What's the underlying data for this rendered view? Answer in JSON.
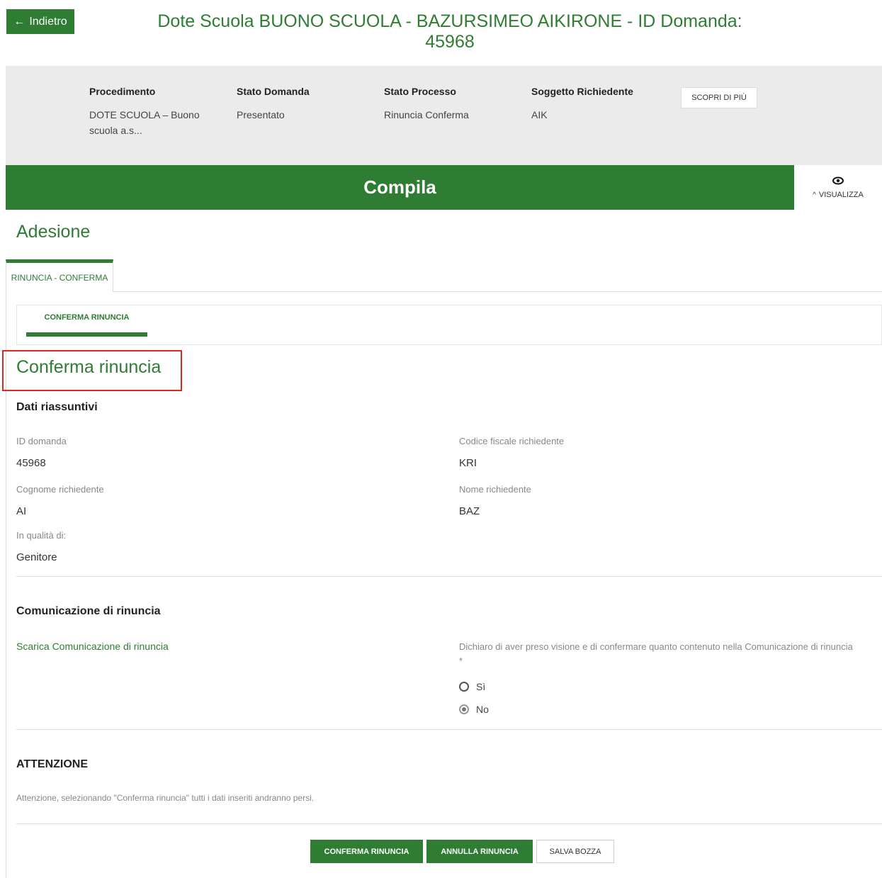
{
  "header": {
    "back_label": "Indietro",
    "back_arrow": "←",
    "title_line1": "Dote Scuola BUONO SCUOLA - BAZURSIMEO AIKIRONE - ID Domanda:",
    "title_line2": "45968"
  },
  "info": {
    "procedimento_label": "Procedimento",
    "procedimento_value": "DOTE SCUOLA – Buono scuola a.s...",
    "stato_domanda_label": "Stato Domanda",
    "stato_domanda_value": "Presentato",
    "stato_processo_label": "Stato Processo",
    "stato_processo_value": "Rinuncia Conferma",
    "soggetto_label": "Soggetto Richiedente",
    "soggetto_value": "AIK",
    "scopri_label": "SCOPRI DI PIÙ"
  },
  "bar": {
    "compila_label": "Compila",
    "visualizza_label": "VISUALIZZA"
  },
  "section_title": "Adesione",
  "tabs": {
    "main_tab": "RINUNCIA - CONFERMA",
    "sub_tab": "CONFERMA RINUNCIA"
  },
  "form": {
    "title": "Conferma rinuncia",
    "dati_heading": "Dati riassuntivi",
    "id_domanda_label": "ID domanda",
    "id_domanda_value": "45968",
    "codice_fiscale_label": "Codice fiscale richiedente",
    "codice_fiscale_value": "KRI",
    "cognome_label": "Cognome richiedente",
    "cognome_value": "AI",
    "nome_label": "Nome richiedente",
    "nome_value": "BAZ",
    "qualita_label": "In qualità di:",
    "qualita_value": "Genitore",
    "comunicazione_heading": "Comunicazione di rinuncia",
    "scarica_link": "Scarica Comunicazione di rinuncia",
    "dichiaro_label": "Dichiaro di aver preso visione e di confermare quanto contenuto nella Comunicazione di rinuncia *",
    "radio_si": "Sì",
    "radio_no": "No",
    "attenzione_heading": "ATTENZIONE",
    "attenzione_text": "Attenzione, selezionando \"Conferma rinuncia\" tutti i dati inseriti andranno persi."
  },
  "actions": {
    "conferma_label": "CONFERMA RINUNCIA",
    "annulla_label": "ANNULLA RINUNCIA",
    "salva_label": "SALVA BOZZA"
  },
  "colors": {
    "brand_green": "#2e7d32",
    "highlight_red": "#e0261f"
  }
}
